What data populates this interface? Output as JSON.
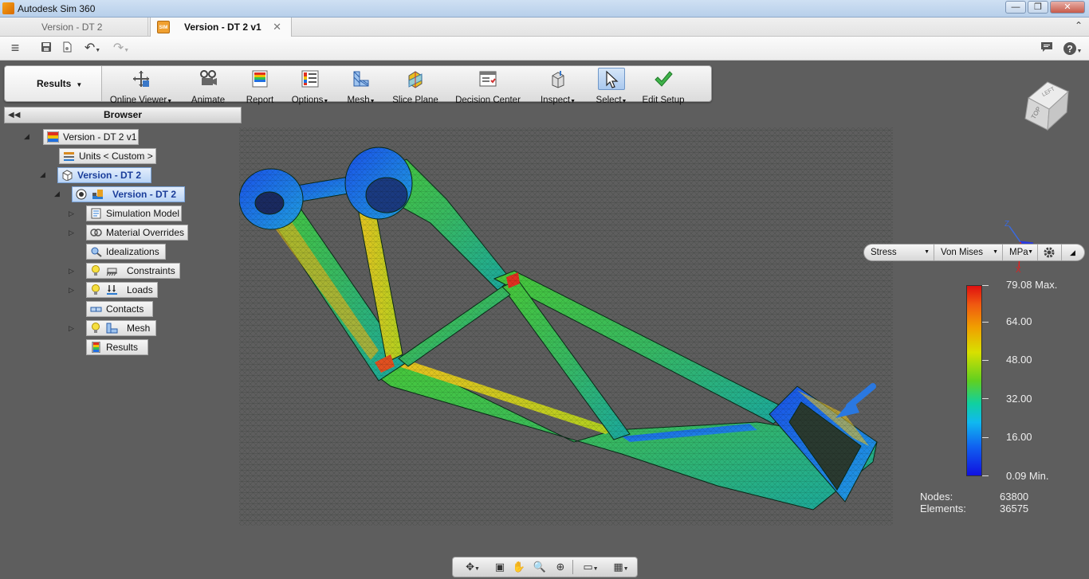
{
  "window": {
    "title": "Autodesk Sim 360",
    "minimize": "—",
    "maximize": "❐",
    "close": "✕"
  },
  "tabs": [
    {
      "label": "Version - DT 2"
    },
    {
      "label": "Version - DT 2 v1",
      "close": "✕",
      "icon_text": "SIM"
    }
  ],
  "ribbon": {
    "workspace": "Results",
    "tools": [
      {
        "label": "Online Viewer",
        "dropdown": true
      },
      {
        "label": "Animate"
      },
      {
        "label": "Report"
      },
      {
        "label": "Options",
        "dropdown": true
      },
      {
        "label": "Mesh",
        "dropdown": true
      },
      {
        "label": "Slice Plane"
      },
      {
        "label": "Decision Center"
      },
      {
        "label": "Inspect",
        "dropdown": true
      },
      {
        "label": "Select",
        "dropdown": true
      },
      {
        "label": "Edit Setup"
      }
    ]
  },
  "browser": {
    "title": "Browser",
    "root": "Version - DT 2 v1",
    "units": "Units < Custom >",
    "design": "Version - DT 2",
    "study": "Version - DT 2",
    "items": [
      {
        "label": "Simulation Model"
      },
      {
        "label": "Material Overrides"
      },
      {
        "label": "Idealizations"
      },
      {
        "label": "Constraints"
      },
      {
        "label": "Loads"
      },
      {
        "label": "Contacts"
      },
      {
        "label": "Mesh"
      },
      {
        "label": "Results"
      }
    ]
  },
  "results_bar": {
    "result_type": "Stress",
    "component": "Von Mises",
    "units": "MPa"
  },
  "legend": {
    "max_label": "79.08 Max.",
    "min_label": "0.09 Min.",
    "ticks": [
      "64.00",
      "48.00",
      "32.00",
      "16.00"
    ]
  },
  "stats": {
    "nodes_label": "Nodes:",
    "nodes_value": "63800",
    "elements_label": "Elements:",
    "elements_value": "36575"
  },
  "viewcube": {
    "face_top": "TOP",
    "face_left": "LEFT"
  },
  "triad": {
    "z": "Z",
    "x": "X"
  },
  "colors": {
    "accent": "#2f6fd0",
    "background": "#5e5e5e",
    "legend_max": "#e01010",
    "legend_min": "#1010e0"
  }
}
